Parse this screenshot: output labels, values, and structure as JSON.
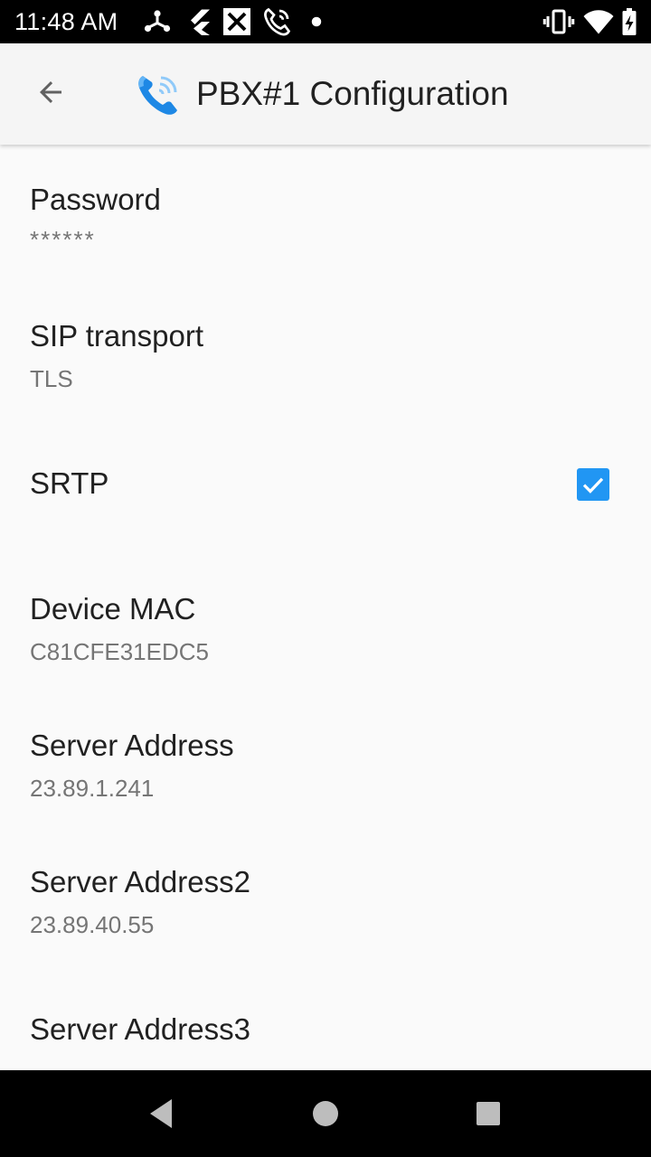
{
  "status_bar": {
    "time": "11:48 AM",
    "left_icons": [
      "network-share-icon",
      "flutter-icon",
      "x-box-icon",
      "wifi-calling-icon",
      "dot-icon"
    ],
    "right_icons": [
      "vibrate-icon",
      "wifi-icon",
      "battery-charging-icon"
    ]
  },
  "toolbar": {
    "back_icon": "arrow-back-icon",
    "logo_icon": "phone-logo-icon",
    "title": "PBX#1 Configuration"
  },
  "preferences": [
    {
      "title": "Password",
      "summary": "******"
    },
    {
      "title": "SIP transport",
      "summary": "TLS"
    },
    {
      "title": "SRTP",
      "checked": true
    },
    {
      "title": "Device MAC",
      "summary": "C81CFE31EDC5"
    },
    {
      "title": "Server Address",
      "summary": "23.89.1.241"
    },
    {
      "title": "Server Address2",
      "summary": "23.89.40.55"
    },
    {
      "title": "Server Address3",
      "summary": ""
    }
  ],
  "nav_bar": {
    "back": "nav-back-icon",
    "home": "nav-home-icon",
    "recents": "nav-recents-icon"
  },
  "colors": {
    "accent": "#2196f3",
    "background": "#fafafa",
    "toolbar": "#f5f5f5"
  }
}
